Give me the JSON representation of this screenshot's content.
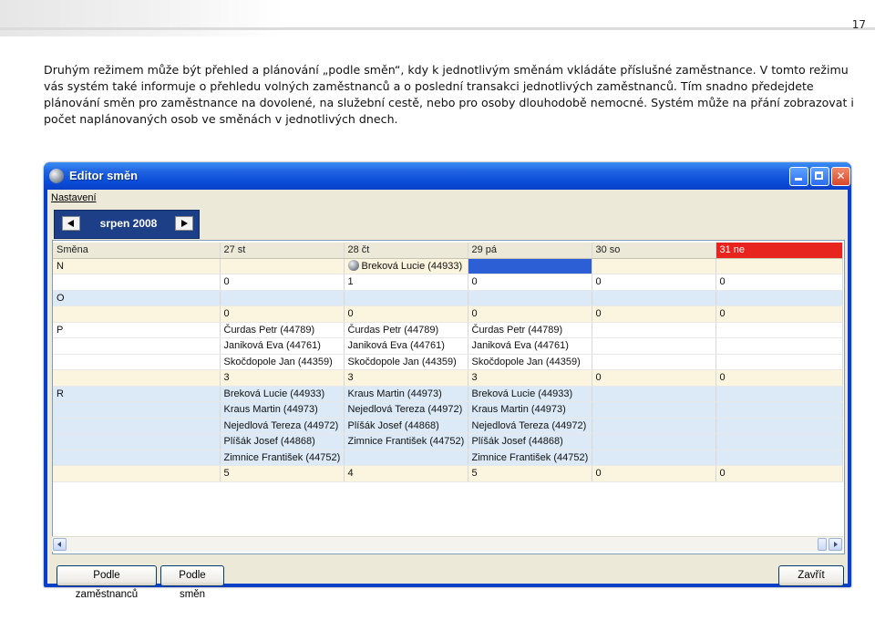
{
  "page_number": "17",
  "intro_text": "Druhým režimem může být přehled a plánování „podle směn“, kdy k jednotlivým směnám vkládáte příslušné zaměstnance. V tomto režimu vás systém také informuje o přehledu volných zaměstnanců a o poslední transakci jednotlivých zaměstnanců. Tím snadno předejdete plánování směn pro zaměstnance na dovolené, na služební cestě, nebo pro osoby dlouhodobě nemocné. Systém může na přání zobrazovat i počet naplánovaných osob ve směnách v jednotlivých dnech.",
  "window": {
    "title": "Editor směn",
    "menu": [
      "Nastavení"
    ]
  },
  "month_nav": {
    "label": "srpen 2008"
  },
  "grid": {
    "headers": [
      "Směna",
      "27 st",
      "28 čt",
      "29 pá",
      "30 so",
      "31 ne"
    ],
    "rows": [
      [
        "N",
        "",
        "Breková Lucie (44933)",
        "",
        "",
        ""
      ],
      [
        "",
        "0",
        "1",
        "0",
        "0",
        "0"
      ],
      [
        "O",
        "",
        "",
        "",
        "",
        ""
      ],
      [
        "",
        "0",
        "0",
        "0",
        "0",
        "0"
      ],
      [
        "P",
        "Čurdas Petr (44789)",
        "Čurdas Petr (44789)",
        "Čurdas Petr (44789)",
        "",
        ""
      ],
      [
        "",
        "Janiková Eva (44761)",
        "Janiková Eva (44761)",
        "Janiková Eva (44761)",
        "",
        ""
      ],
      [
        "",
        "Skočdopole Jan (44359)",
        "Skočdopole Jan (44359)",
        "Skočdopole Jan (44359)",
        "",
        ""
      ],
      [
        "",
        "3",
        "3",
        "3",
        "0",
        "0"
      ],
      [
        "R",
        "Breková Lucie (44933)",
        "Kraus Martin (44973)",
        "Breková Lucie (44933)",
        "",
        ""
      ],
      [
        "",
        "Kraus Martin (44973)",
        "Nejedlová Tereza (44972)",
        "Kraus Martin (44973)",
        "",
        ""
      ],
      [
        "",
        "Nejedlová Tereza (44972)",
        "Plíšák Josef (44868)",
        "Nejedlová Tereza (44972)",
        "",
        ""
      ],
      [
        "",
        "Plíšák Josef (44868)",
        "Zimnice František (44752)",
        "Plíšák Josef (44868)",
        "",
        ""
      ],
      [
        "",
        "Zimnice František (44752)",
        "",
        "Zimnice František (44752)",
        "",
        ""
      ],
      [
        "",
        "5",
        "4",
        "5",
        "0",
        "0"
      ]
    ]
  },
  "buttons": {
    "by_employees": "Podle zaměstnanců",
    "by_shifts": "Podle směn",
    "close": "Zavřít"
  },
  "colors": {
    "weekend_header": "#e8241e",
    "selection": "#2c5fd6",
    "window_frame": "#0a3fc8"
  }
}
